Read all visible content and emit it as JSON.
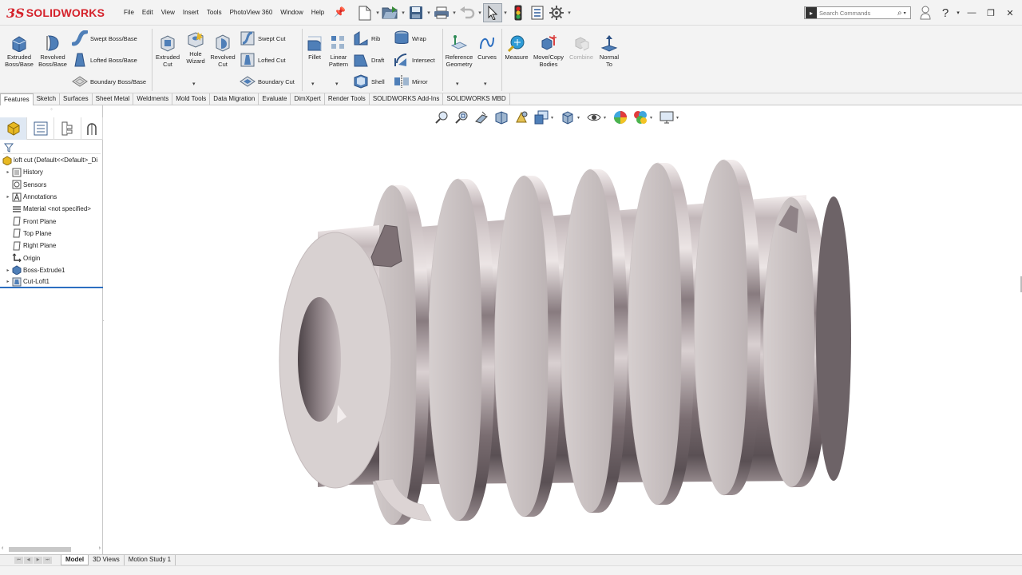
{
  "app": {
    "brand_ds": "3S",
    "brand_name": "SOLIDWORKS"
  },
  "menu": [
    "File",
    "Edit",
    "View",
    "Insert",
    "Tools",
    "PhotoView 360",
    "Window",
    "Help"
  ],
  "quick_access": [
    "new-document-icon",
    "open-icon",
    "save-icon",
    "print-icon",
    "undo-icon",
    "select-icon",
    "rebuild-icon",
    "file-properties-icon",
    "options-icon"
  ],
  "search": {
    "placeholder": "Search Commands"
  },
  "command_manager": {
    "extruded_boss": "Extruded\nBoss/Base",
    "revolved_boss": "Revolved\nBoss/Base",
    "swept_boss": "Swept Boss/Base",
    "lofted_boss": "Lofted Boss/Base",
    "boundary_boss": "Boundary Boss/Base",
    "extruded_cut": "Extruded\nCut",
    "hole_wizard": "Hole\nWizard",
    "revolved_cut": "Revolved\nCut",
    "swept_cut": "Swept Cut",
    "lofted_cut": "Lofted Cut",
    "boundary_cut": "Boundary Cut",
    "fillet": "Fillet",
    "linear_pattern": "Linear\nPattern",
    "rib": "Rib",
    "draft": "Draft",
    "shell": "Shell",
    "wrap": "Wrap",
    "intersect": "Intersect",
    "mirror": "Mirror",
    "reference_geometry": "Reference\nGeometry",
    "curves": "Curves",
    "measure": "Measure",
    "move_copy_bodies": "Move/Copy\nBodies",
    "combine": "Combine",
    "normal_to": "Normal\nTo"
  },
  "tabs": [
    "Features",
    "Sketch",
    "Surfaces",
    "Sheet Metal",
    "Weldments",
    "Mold Tools",
    "Data Migration",
    "Evaluate",
    "DimXpert",
    "Render Tools",
    "SOLIDWORKS Add-Ins",
    "SOLIDWORKS MBD"
  ],
  "active_tab": "Features",
  "feature_tree": {
    "root": "loft cut  (Default<<Default>_Di",
    "items": [
      {
        "label": "History",
        "expandable": true
      },
      {
        "label": "Sensors",
        "expandable": false
      },
      {
        "label": "Annotations",
        "expandable": true
      },
      {
        "label": "Material <not specified>",
        "expandable": false
      },
      {
        "label": "Front Plane",
        "expandable": false
      },
      {
        "label": "Top Plane",
        "expandable": false
      },
      {
        "label": "Right Plane",
        "expandable": false
      },
      {
        "label": "Origin",
        "expandable": false
      },
      {
        "label": "Boss-Extrude1",
        "expandable": true
      },
      {
        "label": "Cut-Loft1",
        "expandable": true
      }
    ]
  },
  "bottom_tabs": [
    "Model",
    "3D Views",
    "Motion Study 1"
  ],
  "active_bottom_tab": "Model",
  "colors": {
    "brand_red": "#d5222b",
    "accent_blue": "#2c6fc1",
    "metal_dark": "#6e6468",
    "metal_light": "#e4dcdc"
  }
}
